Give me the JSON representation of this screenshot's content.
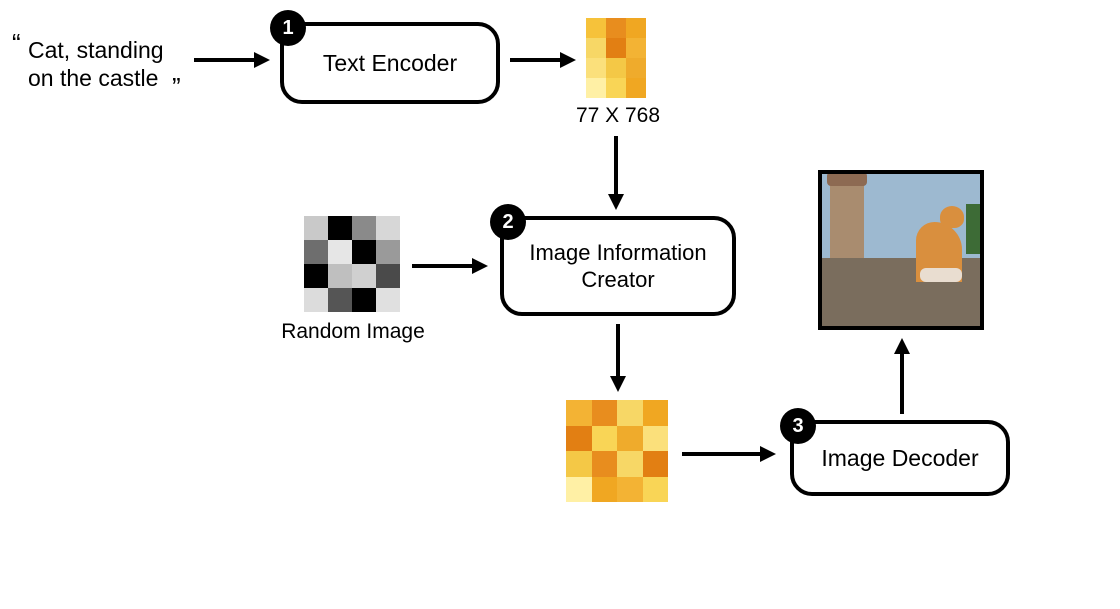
{
  "prompt": {
    "open_quote": "“",
    "close_quote": "”",
    "line1": "Cat, standing",
    "line2": "on the castle"
  },
  "nodes": {
    "text_encoder": {
      "number": "1",
      "label": "Text Encoder"
    },
    "image_info_creator": {
      "number": "2",
      "label": "Image Information\nCreator"
    },
    "image_decoder": {
      "number": "3",
      "label": "Image Decoder"
    }
  },
  "captions": {
    "encoder_output_dim": "77 X 768",
    "random_image": "Random Image"
  },
  "grids": {
    "encoder_output": {
      "rows": 4,
      "cols": 3,
      "colors": [
        "#f6c23a",
        "#e88d1e",
        "#f0a722",
        "#f7d766",
        "#e27f13",
        "#f3b334",
        "#fbe07b",
        "#f4c846",
        "#efab2c",
        "#fff0a5",
        "#f9d556",
        "#f0a722"
      ]
    },
    "random_image": {
      "rows": 4,
      "cols": 4,
      "colors": [
        "#c9c9c9",
        "#000000",
        "#8a8a8a",
        "#d7d7d7",
        "#6e6e6e",
        "#e6e6e6",
        "#000000",
        "#9a9a9a",
        "#000000",
        "#bfbfbf",
        "#d0d0d0",
        "#4a4a4a",
        "#dcdcdc",
        "#555555",
        "#000000",
        "#e0e0e0"
      ]
    },
    "creator_output": {
      "rows": 4,
      "cols": 4,
      "colors": [
        "#f3b334",
        "#e88d1e",
        "#f7d766",
        "#f0a722",
        "#e27f13",
        "#f9d556",
        "#efab2c",
        "#fbe07b",
        "#f4c846",
        "#e88d1e",
        "#f7d766",
        "#e27f13",
        "#fff0a5",
        "#f0a722",
        "#f3b334",
        "#f9d556"
      ]
    }
  }
}
